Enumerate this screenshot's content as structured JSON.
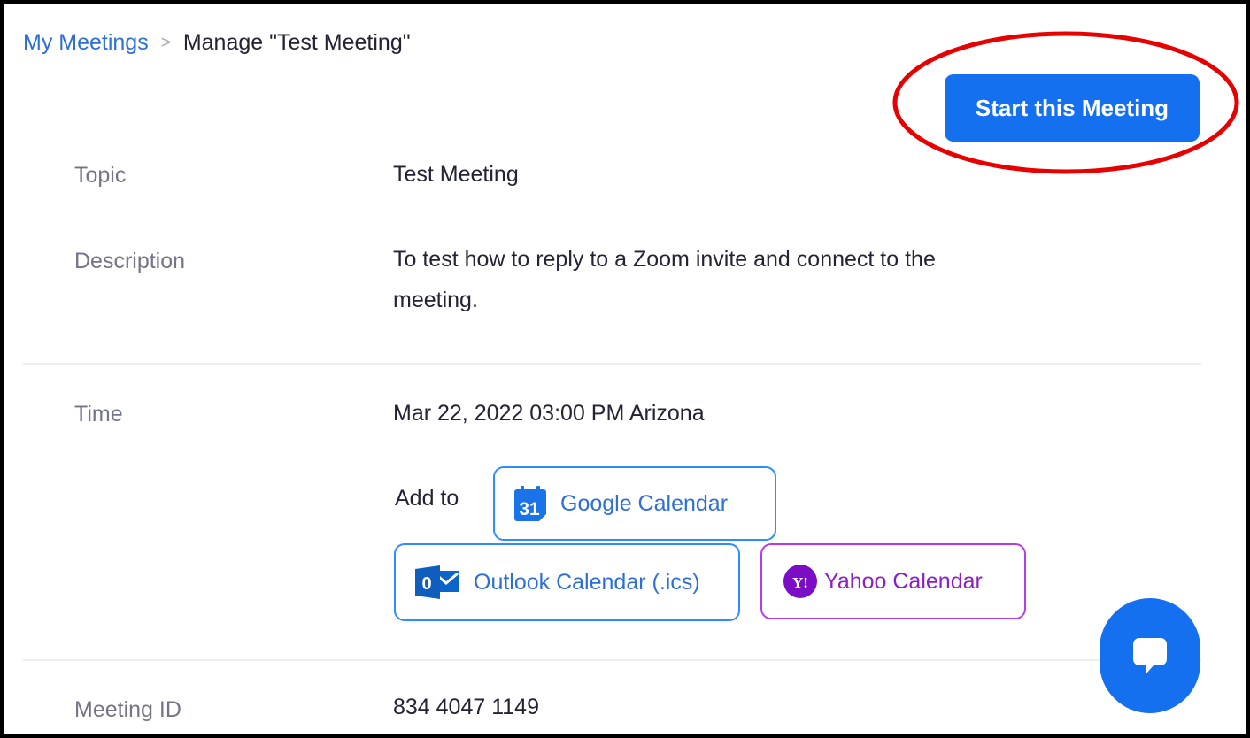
{
  "breadcrumb": {
    "parent": "My Meetings",
    "separator": ">",
    "current": "Manage \"Test Meeting\""
  },
  "actions": {
    "start_label": "Start this Meeting"
  },
  "topic": {
    "label": "Topic",
    "value": "Test Meeting"
  },
  "description": {
    "label": "Description",
    "line1": "To test how to reply to a Zoom invite and connect to the",
    "line2": "meeting."
  },
  "time": {
    "label": "Time",
    "value": "Mar 22, 2022 03:00 PM Arizona",
    "add_to_label": "Add to",
    "calendars": {
      "google": {
        "icon_text": "31",
        "label": "Google Calendar"
      },
      "outlook": {
        "icon_text": "0",
        "label": "Outlook Calendar (.ics)"
      },
      "yahoo": {
        "icon_text": "Y!",
        "label": "Yahoo Calendar"
      }
    }
  },
  "meeting_id": {
    "label": "Meeting ID",
    "value": "834 4047 1149"
  },
  "colors": {
    "primary": "#1570EF",
    "link": "#2D6FD6",
    "yahoo": "#8A1FC7",
    "highlight": "#E60000"
  }
}
